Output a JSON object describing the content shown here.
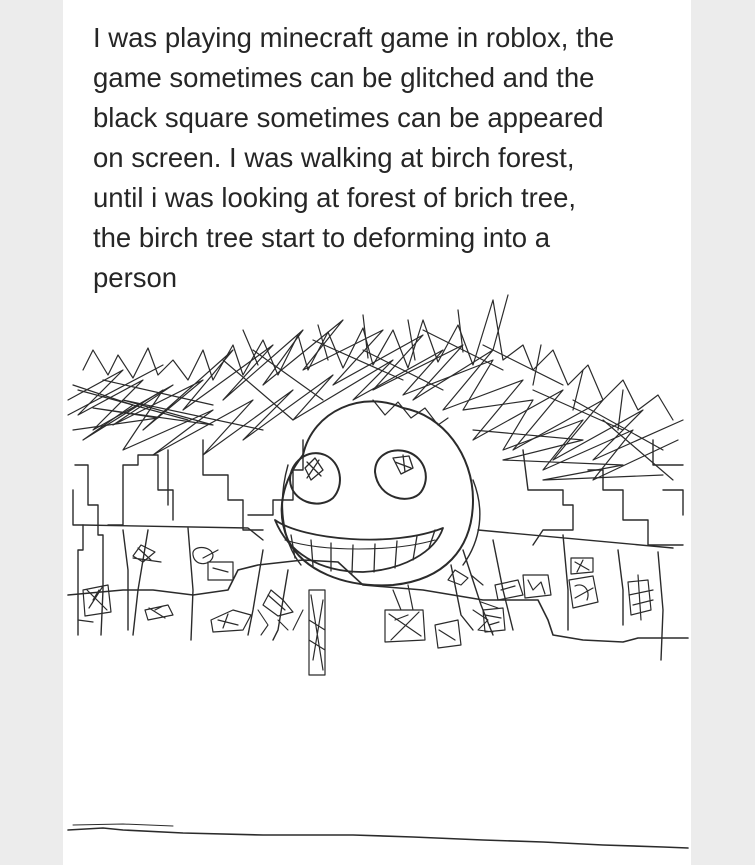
{
  "post": {
    "story_lines": [
      "I was playing minecraft game in roblox, the",
      "game sometimes can be glitched and the",
      "black square sometimes can be appeared",
      "on screen. I was walking at birch forest,",
      "until i was looking at forest of brich tree,",
      "the birch tree start to deforming into a",
      "person"
    ]
  },
  "colors": {
    "page_background": "#ececec",
    "card_background": "#ffffff",
    "text": "#262626",
    "ink": "#2b2b2b"
  },
  "icons": [
    "sketch-drawing"
  ]
}
